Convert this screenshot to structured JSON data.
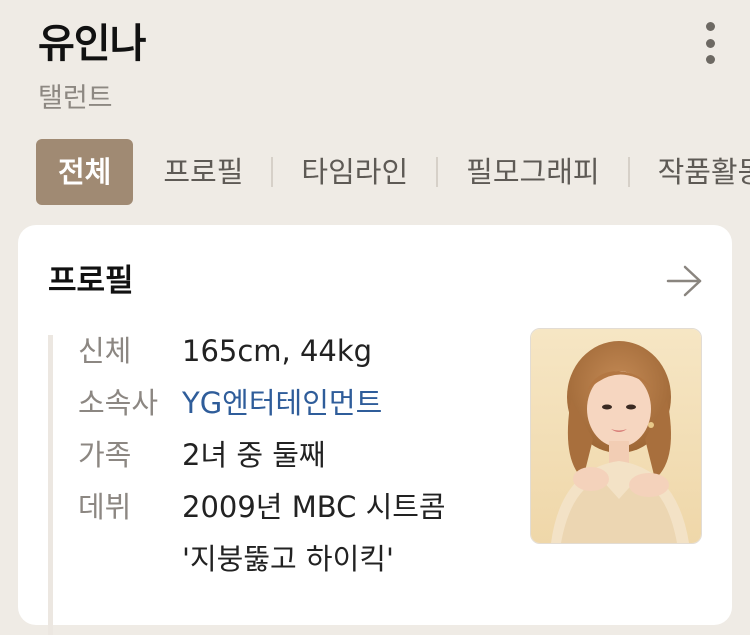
{
  "header": {
    "name": "유인나",
    "occupation": "탤런트",
    "more_icon": "more-vertical-icon"
  },
  "tabs": [
    {
      "label": "전체",
      "active": true
    },
    {
      "label": "프로필",
      "active": false
    },
    {
      "label": "타임라인",
      "active": false
    },
    {
      "label": "필모그래피",
      "active": false
    },
    {
      "label": "작품활동",
      "active": false
    }
  ],
  "profile_card": {
    "title": "프로필",
    "arrow_icon": "arrow-right-icon",
    "rows": [
      {
        "label": "신체",
        "value": "165cm, 44kg"
      },
      {
        "label": "소속사",
        "value": "YG엔터테인먼트"
      },
      {
        "label": "가족",
        "value": "2녀 중 둘째"
      },
      {
        "label": "데뷔",
        "value": "2009년 MBC 시트콤\n'지붕뚫고 하이킥'"
      }
    ]
  },
  "colors": {
    "background": "#efebe5",
    "active_tab": "#a08a73",
    "link": "#2f5d9a",
    "label": "#8c8782"
  }
}
